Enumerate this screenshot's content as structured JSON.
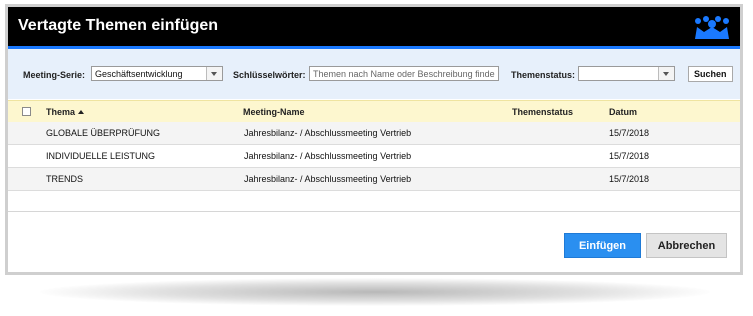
{
  "dialog": {
    "title": "Vertagte Themen einfügen"
  },
  "filters": {
    "series_label": "Meeting-Serie:",
    "series_value": "Geschäftsentwicklung",
    "keywords_label": "Schlüsselwörter:",
    "keywords_value": "",
    "keywords_placeholder": "Themen nach Name oder Beschreibung finden",
    "status_label": "Themenstatus:",
    "status_value": "",
    "search_label": "Suchen"
  },
  "table": {
    "columns": {
      "topic": "Thema",
      "meeting": "Meeting-Name",
      "status": "Themenstatus",
      "date": "Datum"
    },
    "sort": {
      "column": "topic",
      "direction": "asc"
    },
    "rows": [
      {
        "topic": "GLOBALE ÜBERPRÜFUNG",
        "meeting": "Jahresbilanz- / Abschlussmeeting Vertrieb",
        "status": "",
        "date": "15/7/2018"
      },
      {
        "topic": "INDIVIDUELLE LEISTUNG",
        "meeting": "Jahresbilanz- / Abschlussmeeting Vertrieb",
        "status": "",
        "date": "15/7/2018"
      },
      {
        "topic": "TRENDS",
        "meeting": "Jahresbilanz- / Abschlussmeeting Vertrieb",
        "status": "",
        "date": "15/7/2018"
      }
    ]
  },
  "footer": {
    "insert_label": "Einfügen",
    "cancel_label": "Abbrechen"
  },
  "icons": {
    "logo": "crown-people-logo-icon",
    "sort": "sort-ascending-icon",
    "dropdown": "chevron-down-icon"
  },
  "colors": {
    "titlebar": "#000000",
    "accent": "#1a79ff",
    "filterbar": "#e7f0fb",
    "table_header": "#fdf7cf",
    "primary_button": "#2a8ff0",
    "secondary_button": "#e4e4e4"
  }
}
